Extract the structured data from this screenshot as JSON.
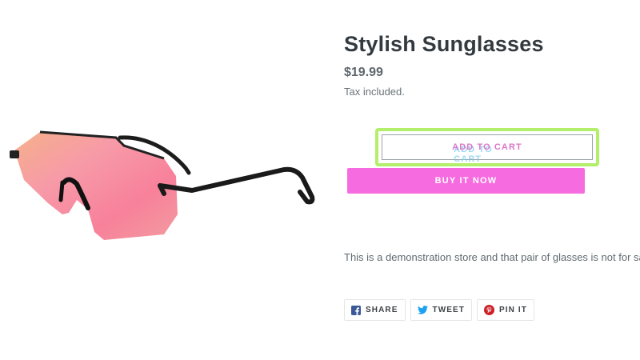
{
  "product": {
    "title": "Stylish Sunglasses",
    "price": "$19.99",
    "tax_note": "Tax included.",
    "description": "This is a demonstration store and that pair of glasses is not for sale.",
    "image_alt": "sunglasses-image"
  },
  "buttons": {
    "add_to_cart": "ADD TO CART",
    "buy_now": "BUY IT NOW"
  },
  "share": [
    {
      "label": "SHARE",
      "icon": "facebook-icon"
    },
    {
      "label": "TWEET",
      "icon": "twitter-icon"
    },
    {
      "label": "PIN IT",
      "icon": "pinterest-icon"
    }
  ],
  "colors": {
    "buy_now_bg": "#f76be0",
    "focus_ring": "#b4ef6c",
    "lens_pink": "#f7889a",
    "lens_orange": "#f6a878",
    "facebook": "#3b5998",
    "twitter": "#1da1f2",
    "pinterest": "#cb2027"
  }
}
